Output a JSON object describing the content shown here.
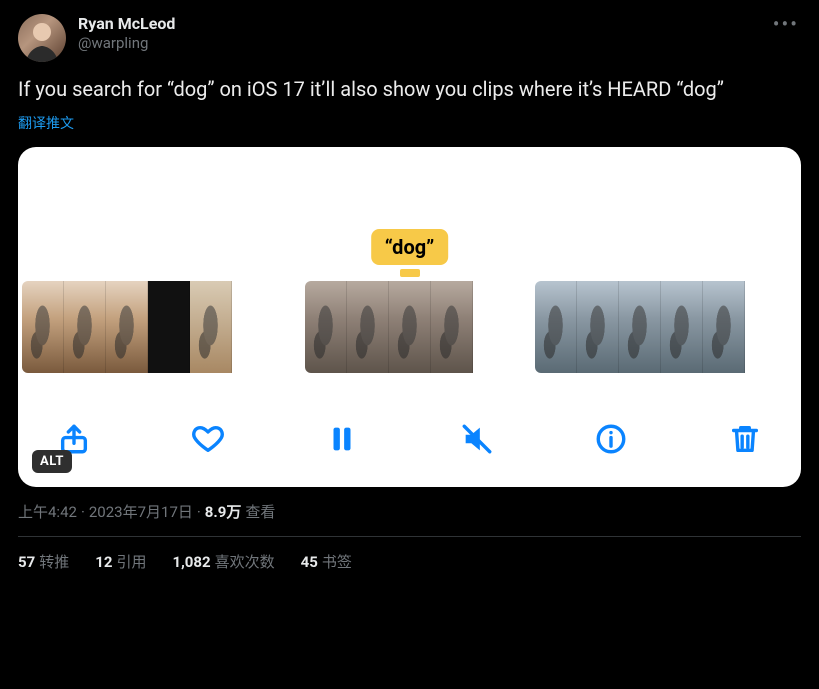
{
  "author": {
    "display_name": "Ryan McLeod",
    "handle": "@warpling"
  },
  "tweet_text": "If you search for “dog” on iOS 17 it’ll also show you clips where it’s HEARD “dog”",
  "translate_label": "翻译推文",
  "media": {
    "caption_bubble": "“dog”",
    "alt_badge": "ALT"
  },
  "meta": {
    "time": "上午4:42",
    "sep1": " · ",
    "date": "2023年7月17日",
    "sep2": " · ",
    "views_n": "8.9万",
    "views_label": " 查看"
  },
  "stats": {
    "retweets_n": "57",
    "retweets_label": "转推",
    "quotes_n": "12",
    "quotes_label": "引用",
    "likes_n": "1,082",
    "likes_label": "喜欢次数",
    "bookmarks_n": "45",
    "bookmarks_label": "书签"
  }
}
